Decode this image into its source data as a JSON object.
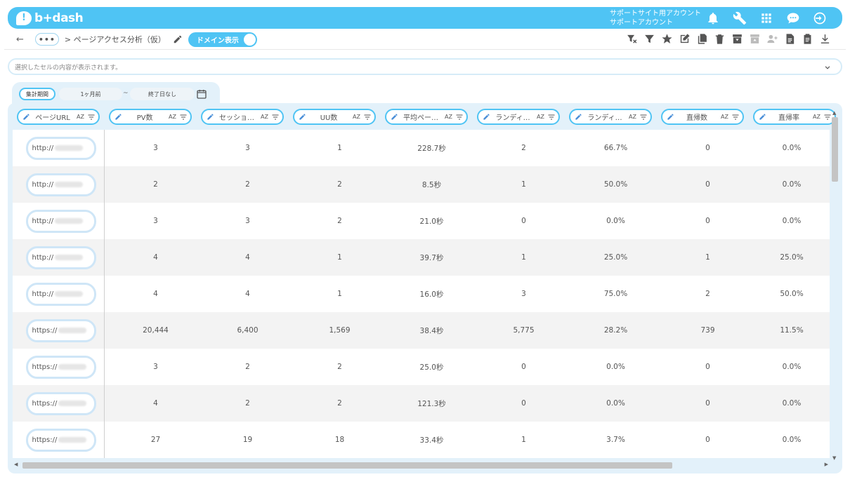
{
  "app": {
    "logo_mark": "!",
    "logo_text": "b+dash",
    "brand_color": "#4fc4f4"
  },
  "account": {
    "line1": "サポートサイト用アカウント",
    "line2": "サポートアカウント"
  },
  "top_icons": [
    "bell-icon",
    "wrench-icon",
    "apps-grid-icon",
    "chat-bubble-icon",
    "logout-icon"
  ],
  "breadcrumb": {
    "back": "←",
    "more": "•••",
    "path": "> ページアクセス分析（仮）"
  },
  "domain_toggle": {
    "label": "ドメイン表示",
    "on": true
  },
  "toolbar_icons": [
    "filter-clear-icon",
    "filter-icon",
    "star-icon",
    "edit-icon",
    "copy-icon",
    "trash-icon",
    "archive-icon",
    "archive-disabled-icon",
    "share-user-disabled-icon",
    "document-icon",
    "clipboard-icon",
    "download-icon"
  ],
  "cell_info": {
    "text": "選択したセルの内容が表示されます。"
  },
  "period": {
    "label": "集計期間",
    "from": "1ヶ月前",
    "separator": "~",
    "to": "終了日なし"
  },
  "columns": [
    {
      "label": "ページURL"
    },
    {
      "label": "PV数"
    },
    {
      "label": "セッショ…"
    },
    {
      "label": "UU数"
    },
    {
      "label": "平均ペー…"
    },
    {
      "label": "ランディ…"
    },
    {
      "label": "ランディ…"
    },
    {
      "label": "直帰数"
    },
    {
      "label": "直帰率"
    }
  ],
  "sort_label": "AZ",
  "rows": [
    {
      "url": "http://",
      "pv": "3",
      "sessions": "3",
      "uu": "1",
      "avg": "228.7秒",
      "landing": "2",
      "landing_rate": "66.7%",
      "bounces": "0",
      "bounce_rate": "0.0%"
    },
    {
      "url": "http://",
      "pv": "2",
      "sessions": "2",
      "uu": "2",
      "avg": "8.5秒",
      "landing": "1",
      "landing_rate": "50.0%",
      "bounces": "0",
      "bounce_rate": "0.0%"
    },
    {
      "url": "http://",
      "pv": "3",
      "sessions": "3",
      "uu": "2",
      "avg": "21.0秒",
      "landing": "0",
      "landing_rate": "0.0%",
      "bounces": "0",
      "bounce_rate": "0.0%"
    },
    {
      "url": "http://",
      "pv": "4",
      "sessions": "4",
      "uu": "1",
      "avg": "39.7秒",
      "landing": "1",
      "landing_rate": "25.0%",
      "bounces": "1",
      "bounce_rate": "25.0%"
    },
    {
      "url": "http://",
      "pv": "4",
      "sessions": "4",
      "uu": "1",
      "avg": "16.0秒",
      "landing": "3",
      "landing_rate": "75.0%",
      "bounces": "2",
      "bounce_rate": "50.0%"
    },
    {
      "url": "https://",
      "pv": "20,444",
      "sessions": "6,400",
      "uu": "1,569",
      "avg": "38.4秒",
      "landing": "5,775",
      "landing_rate": "28.2%",
      "bounces": "739",
      "bounce_rate": "11.5%"
    },
    {
      "url": "https://",
      "pv": "3",
      "sessions": "2",
      "uu": "2",
      "avg": "25.0秒",
      "landing": "0",
      "landing_rate": "0.0%",
      "bounces": "0",
      "bounce_rate": "0.0%"
    },
    {
      "url": "https://",
      "pv": "4",
      "sessions": "2",
      "uu": "2",
      "avg": "121.3秒",
      "landing": "0",
      "landing_rate": "0.0%",
      "bounces": "0",
      "bounce_rate": "0.0%"
    },
    {
      "url": "https://",
      "pv": "27",
      "sessions": "19",
      "uu": "18",
      "avg": "33.4秒",
      "landing": "1",
      "landing_rate": "3.7%",
      "bounces": "0",
      "bounce_rate": "0.0%"
    }
  ]
}
